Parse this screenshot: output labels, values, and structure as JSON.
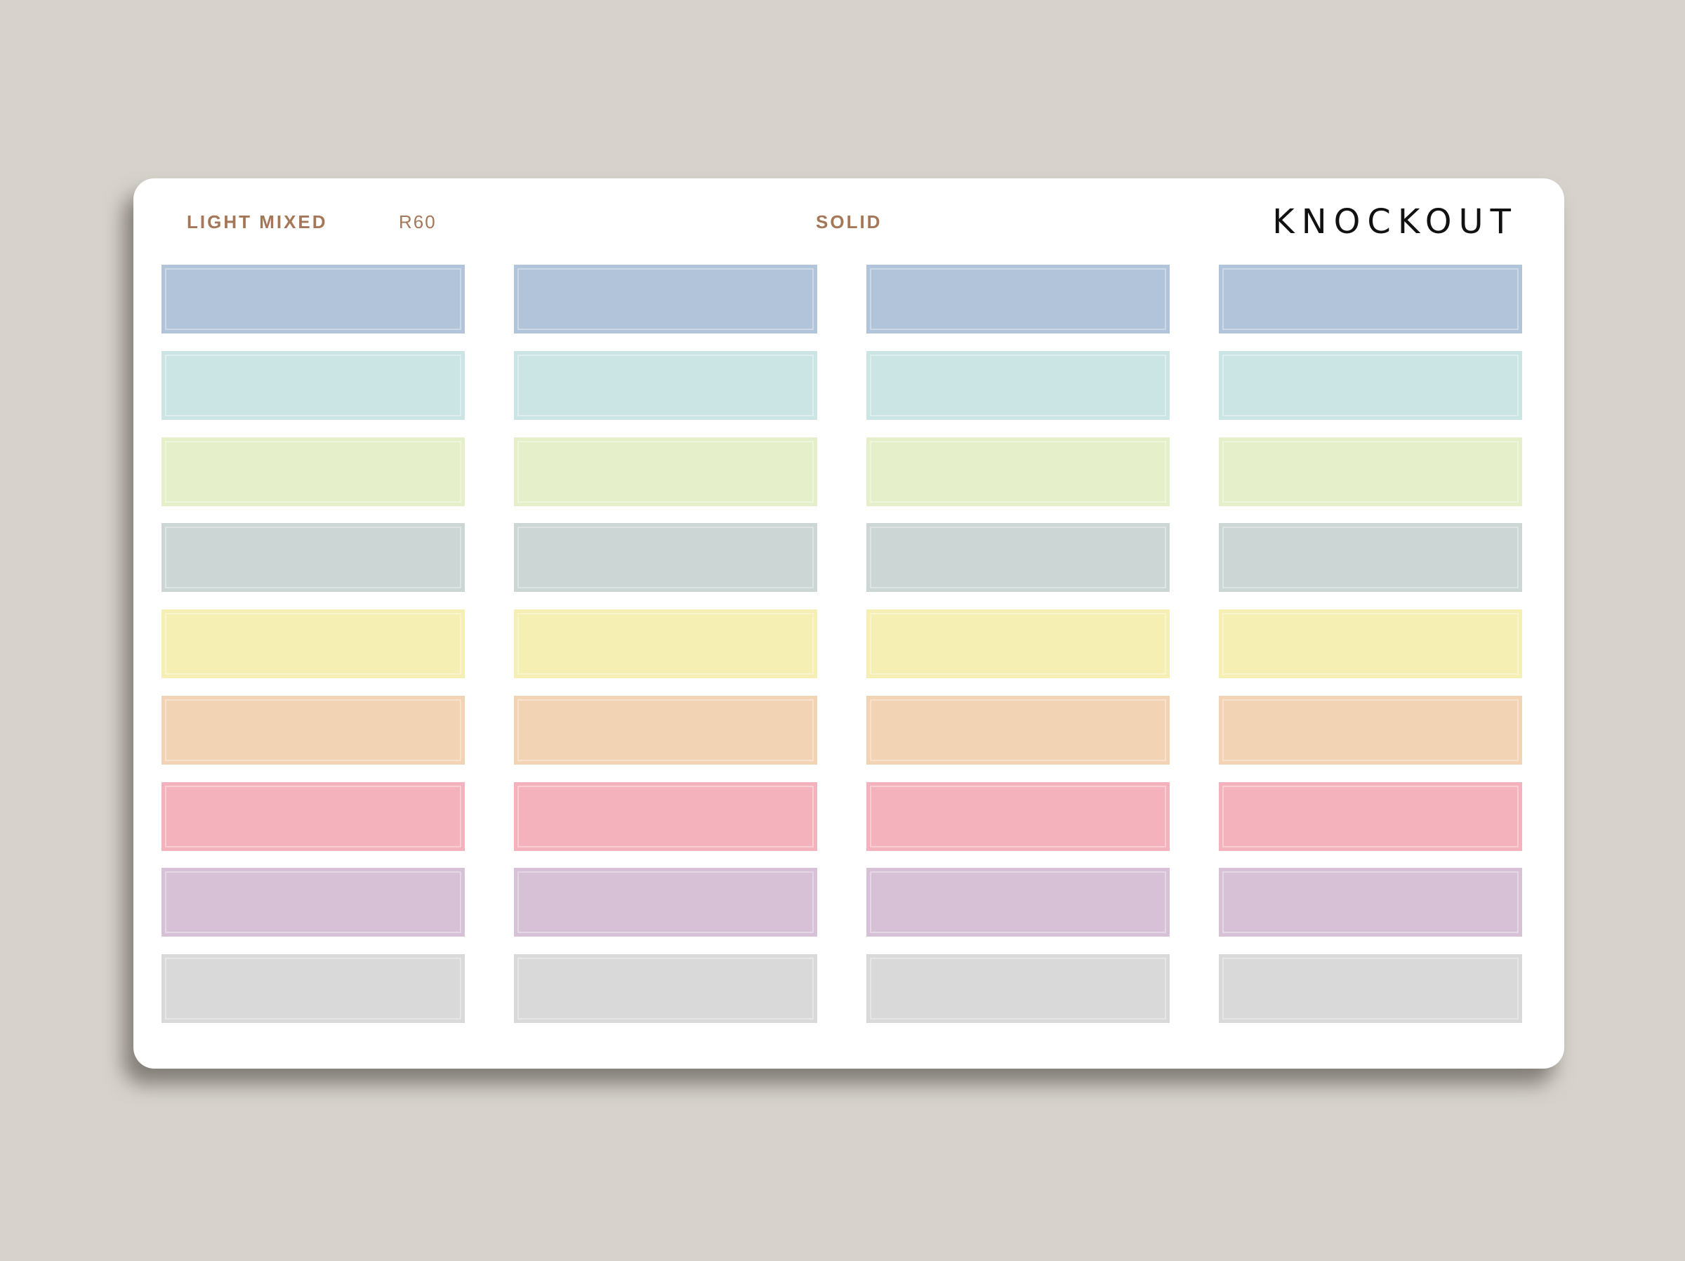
{
  "sheet": {
    "label_left": "LIGHT MIXED",
    "code": "R60",
    "label_center": "SOLID",
    "brand": "KNOCKOUT"
  },
  "stickers": {
    "columns": 4,
    "row_colors": [
      {
        "name": "blue",
        "hex": "#b1c4d9"
      },
      {
        "name": "aqua",
        "hex": "#cbe5e4"
      },
      {
        "name": "light-green",
        "hex": "#e5f0ca"
      },
      {
        "name": "gray-green",
        "hex": "#cbd6d5"
      },
      {
        "name": "yellow",
        "hex": "#f5efb4"
      },
      {
        "name": "peach",
        "hex": "#f2d3b4"
      },
      {
        "name": "pink",
        "hex": "#f4b3bc"
      },
      {
        "name": "lavender",
        "hex": "#d7c1d6"
      },
      {
        "name": "gray",
        "hex": "#d9d9d9"
      }
    ]
  },
  "colors": {
    "background": "#d7d3cc",
    "sheet": "#ffffff",
    "header_text": "#a47758",
    "brand_text": "#111111"
  }
}
